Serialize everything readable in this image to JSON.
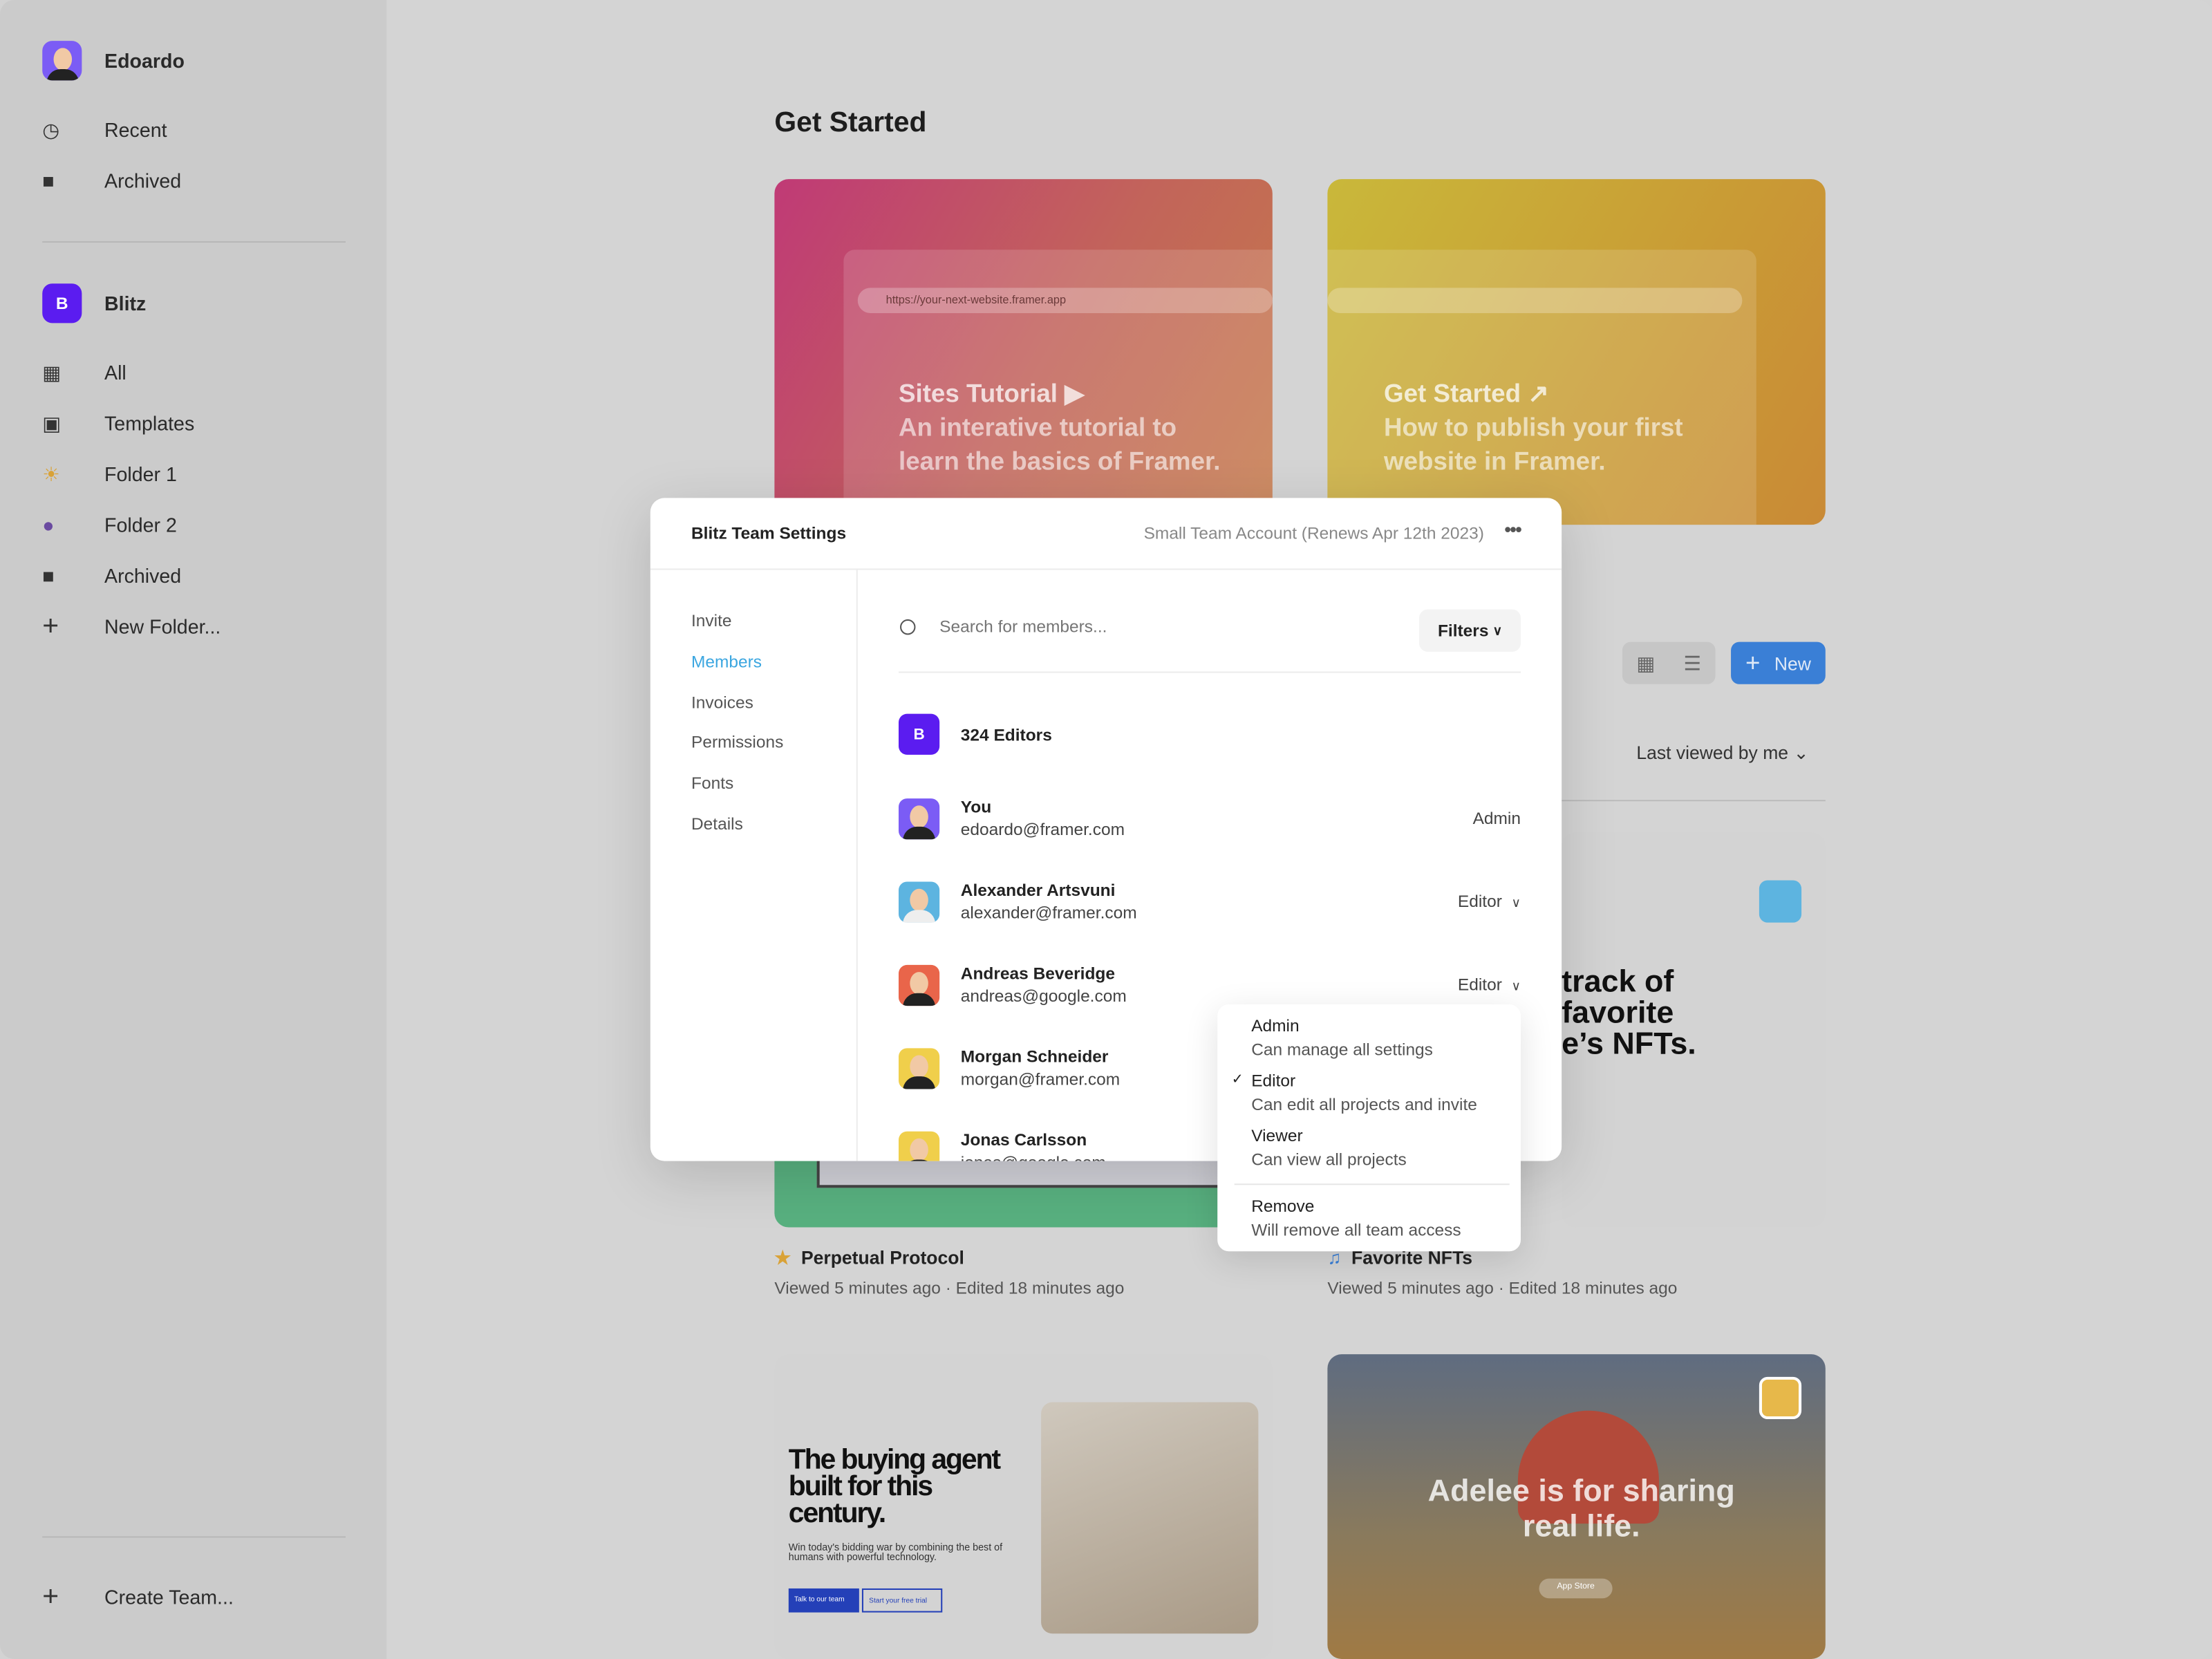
{
  "sidebar": {
    "user": "Edoardo",
    "items_top": [
      {
        "label": "Recent",
        "icon": "clock-icon"
      },
      {
        "label": "Archived",
        "icon": "archive-icon"
      }
    ],
    "team": {
      "name": "Blitz",
      "initial": "B",
      "color": "#5b1cf0"
    },
    "items_team": [
      {
        "label": "All",
        "icon": "grid-icon"
      },
      {
        "label": "Templates",
        "icon": "templates-icon"
      },
      {
        "label": "Folder 1",
        "icon": "folder-emoji-icon"
      },
      {
        "label": "Folder 2",
        "icon": "folder-emoji-icon"
      },
      {
        "label": "Archived",
        "icon": "archive-icon"
      },
      {
        "label": "New Folder...",
        "icon": "plus-icon"
      }
    ],
    "create_team": "Create Team..."
  },
  "main": {
    "title": "Get Started",
    "cards": [
      {
        "url": "https://your-next-website.framer.app",
        "title": "Sites Tutorial",
        "line1": "An interative tutorial to",
        "line2": "learn the basics of Framer."
      },
      {
        "title": "Get Started",
        "line1": "How to publish your first",
        "line2": "website in Framer."
      }
    ],
    "new_label": "New",
    "sort_label": "Last viewed by me",
    "projects": [
      {
        "title": "Perpetual Protocol",
        "sub": "Viewed 5 minutes ago · Edited 18 minutes ago"
      },
      {
        "title": "Favorite NFTs",
        "sub": "Viewed 5 minutes ago · Edited 18 minutes ago",
        "preview": "track of favorite e’s NFTs."
      }
    ],
    "preview3": {
      "headline": "The buying agent built for this century.",
      "body": "Win today's bidding war by combining the best of humans with powerful technology.",
      "btn1": "Talk to our team",
      "btn2": "Start your free trial"
    },
    "preview4": {
      "headline": "Adelee is for sharing real life.",
      "btn": "App Store"
    }
  },
  "modal": {
    "title": "Blitz Team Settings",
    "account": "Small Team Account (Renews Apr 12th 2023)",
    "nav": [
      "Invite",
      "Members",
      "Invoices",
      "Permissions",
      "Fonts",
      "Details"
    ],
    "active_nav": "Members",
    "accent": "#3ba6e0",
    "search_placeholder": "Search for members...",
    "filters": "Filters",
    "group": {
      "initial": "B",
      "label": "324 Editors"
    },
    "members": [
      {
        "name": "You",
        "email": "edoardo@framer.com",
        "role": "Admin",
        "bg": "#7b5cf5"
      },
      {
        "name": "Alexander Artsvuni",
        "email": "alexander@framer.com",
        "role": "Editor",
        "bg": "#5db4e0"
      },
      {
        "name": "Andreas Beveridge",
        "email": "andreas@google.com",
        "role": "Editor",
        "bg": "#e9654a"
      },
      {
        "name": "Morgan Schneider",
        "email": "morgan@framer.com",
        "role": "",
        "bg": "#f0cf4b"
      },
      {
        "name": "Jonas Carlsson",
        "email": "jonas@google.com",
        "role": "",
        "bg": "#f0cf4b"
      }
    ]
  },
  "dropdown": {
    "options": [
      {
        "label": "Admin",
        "desc": "Can manage all settings",
        "checked": false
      },
      {
        "label": "Editor",
        "desc": "Can edit all projects and invite",
        "checked": true
      },
      {
        "label": "Viewer",
        "desc": "Can view all projects",
        "checked": false
      }
    ],
    "remove": {
      "label": "Remove",
      "desc": "Will remove all team access"
    }
  }
}
